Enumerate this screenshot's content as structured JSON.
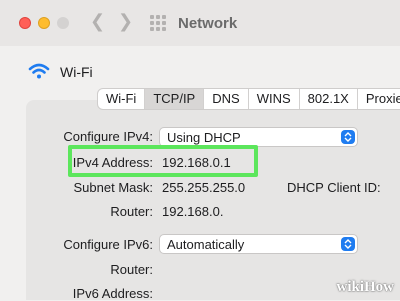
{
  "window": {
    "title": "Network",
    "icons": {
      "back": "chevron-left-icon",
      "forward": "chevron-right-icon",
      "grid": "app-grid-icon"
    }
  },
  "service": {
    "label": "Wi-Fi",
    "icon": "wifi-icon"
  },
  "tabs": [
    {
      "label": "Wi-Fi",
      "selected": false
    },
    {
      "label": "TCP/IP",
      "selected": true
    },
    {
      "label": "DNS",
      "selected": false
    },
    {
      "label": "WINS",
      "selected": false
    },
    {
      "label": "802.1X",
      "selected": false
    },
    {
      "label": "Proxies",
      "selected": false
    }
  ],
  "ipv4": {
    "configure_label": "Configure IPv4:",
    "configure_value": "Using DHCP",
    "address_label": "IPv4 Address:",
    "address_value": "192.168.0.1",
    "subnet_label": "Subnet Mask:",
    "subnet_value": "255.255.255.0",
    "dhcp_client_label": "DHCP Client ID:",
    "router_label": "Router:",
    "router_value": "192.168.0."
  },
  "ipv6": {
    "configure_label": "Configure IPv6:",
    "configure_value": "Automatically",
    "router_label": "Router:",
    "address_label": "IPv6 Address:"
  },
  "highlight_color": "#5ce65c",
  "watermark": {
    "wiki": "wiki",
    "how": "How"
  }
}
